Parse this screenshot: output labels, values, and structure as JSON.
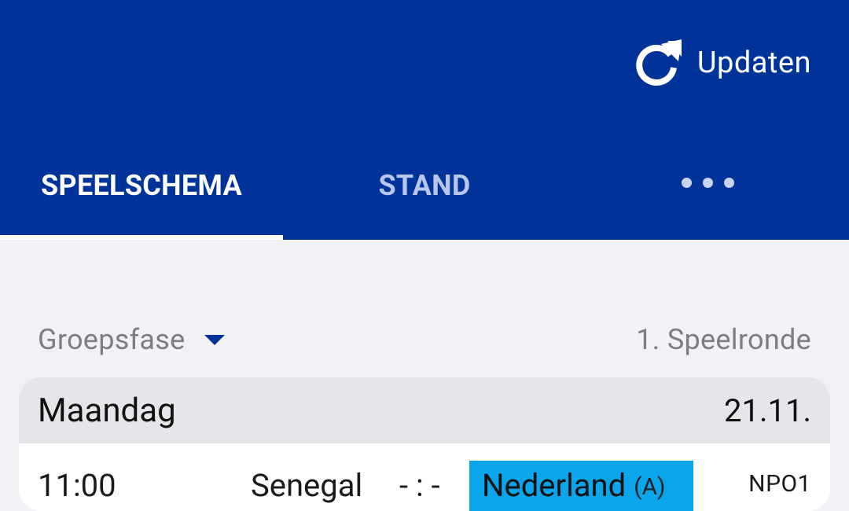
{
  "header": {
    "update_label": "Updaten",
    "update_icon": "refresh-icon",
    "background_color": "#00339a"
  },
  "tabs": [
    {
      "label": "SPEELSCHEMA",
      "selected": true
    },
    {
      "label": "STAND",
      "selected": false
    },
    {
      "label": "",
      "icon": "more-horizontal-icon",
      "selected": false
    }
  ],
  "filters": {
    "phase_label": "Groepsfase",
    "phase_icon": "caret-down-icon",
    "round_label": "1. Speelronde"
  },
  "schedule": {
    "day": "Maandag",
    "date": "21.11.",
    "matches": [
      {
        "time": "11:00",
        "home": "Senegal",
        "score": "- : -",
        "away": "Nederland",
        "group": "(A)",
        "channel": "NPO1",
        "highlight_color": "#0aa5ea"
      }
    ]
  }
}
